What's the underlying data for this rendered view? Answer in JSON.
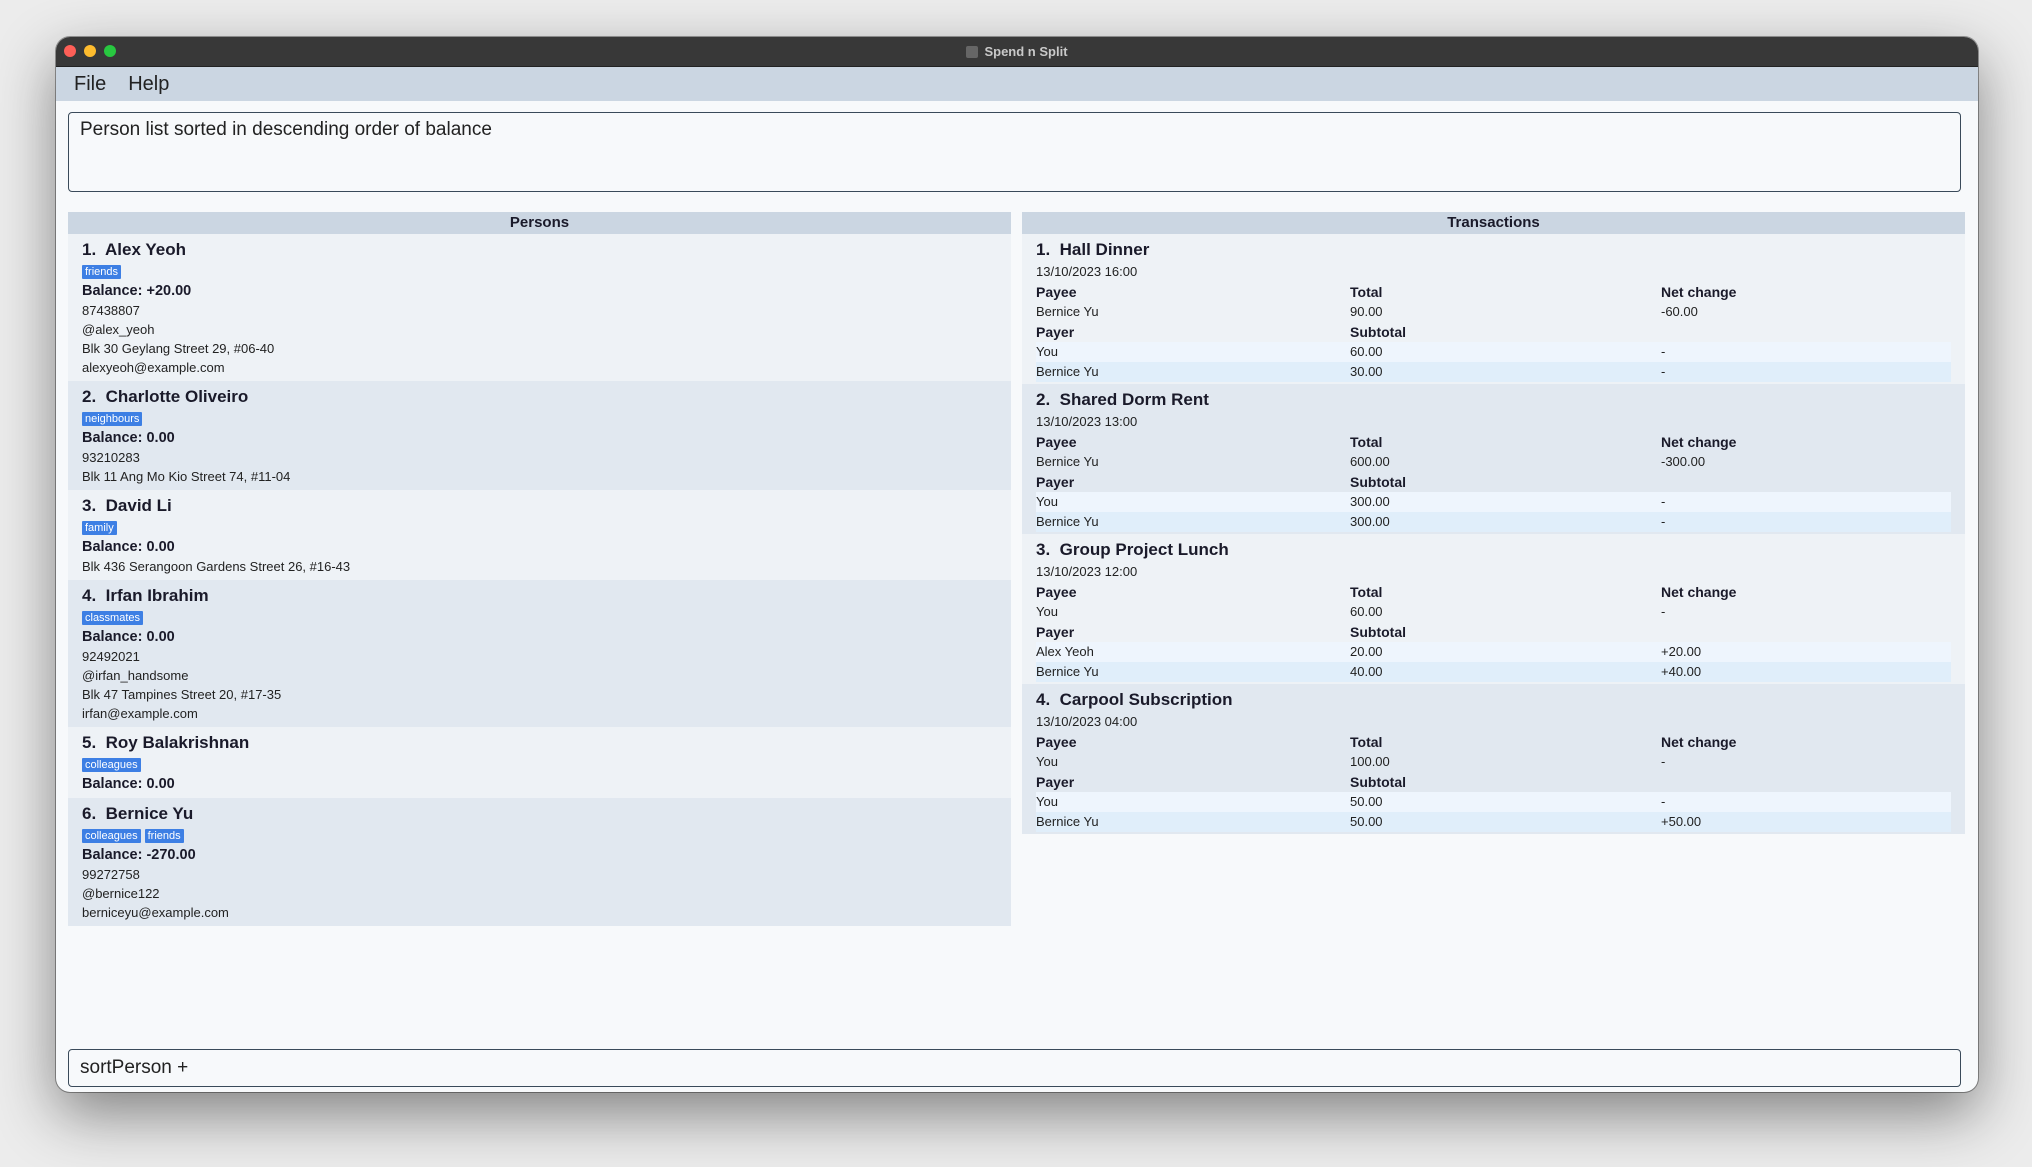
{
  "window": {
    "title": "Spend n Split"
  },
  "menu": {
    "file": "File",
    "help": "Help"
  },
  "result_message": "Person list sorted in descending order of balance",
  "persons_panel": {
    "header": "Persons",
    "items": [
      {
        "index": "1.",
        "name": "Alex Yeoh",
        "tags": [
          "friends"
        ],
        "balance": "Balance: +20.00",
        "details": [
          "87438807",
          "@alex_yeoh",
          "Blk 30 Geylang Street 29, #06-40",
          "alexyeoh@example.com"
        ]
      },
      {
        "index": "2.",
        "name": "Charlotte Oliveiro",
        "tags": [
          "neighbours"
        ],
        "balance": "Balance: 0.00",
        "details": [
          "93210283",
          "Blk 11 Ang Mo Kio Street 74, #11-04"
        ]
      },
      {
        "index": "3.",
        "name": "David Li",
        "tags": [
          "family"
        ],
        "balance": "Balance: 0.00",
        "details": [
          "Blk 436 Serangoon Gardens Street 26, #16-43"
        ]
      },
      {
        "index": "4.",
        "name": "Irfan Ibrahim",
        "tags": [
          "classmates"
        ],
        "balance": "Balance: 0.00",
        "details": [
          "92492021",
          "@irfan_handsome",
          "Blk 47 Tampines Street 20, #17-35",
          "irfan@example.com"
        ]
      },
      {
        "index": "5.",
        "name": "Roy Balakrishnan",
        "tags": [
          "colleagues"
        ],
        "balance": "Balance: 0.00",
        "details": []
      },
      {
        "index": "6.",
        "name": "Bernice Yu",
        "tags": [
          "colleagues",
          "friends"
        ],
        "balance": "Balance: -270.00",
        "details": [
          "99272758",
          "@bernice122",
          "berniceyu@example.com"
        ]
      }
    ]
  },
  "transactions_panel": {
    "header": "Transactions",
    "columns": {
      "payee": "Payee",
      "total": "Total",
      "net_change": "Net change",
      "payer": "Payer",
      "subtotal": "Subtotal"
    },
    "items": [
      {
        "index": "1.",
        "title": "Hall Dinner",
        "datetime": "13/10/2023 16:00",
        "payee": {
          "name": "Bernice Yu",
          "total": "90.00",
          "net": "-60.00"
        },
        "payers": [
          {
            "name": "You",
            "subtotal": "60.00",
            "net": "-"
          },
          {
            "name": "Bernice Yu",
            "subtotal": "30.00",
            "net": "-"
          }
        ]
      },
      {
        "index": "2.",
        "title": "Shared Dorm Rent",
        "datetime": "13/10/2023 13:00",
        "payee": {
          "name": "Bernice Yu",
          "total": "600.00",
          "net": "-300.00"
        },
        "payers": [
          {
            "name": "You",
            "subtotal": "300.00",
            "net": "-"
          },
          {
            "name": "Bernice Yu",
            "subtotal": "300.00",
            "net": "-"
          }
        ]
      },
      {
        "index": "3.",
        "title": "Group Project Lunch",
        "datetime": "13/10/2023 12:00",
        "payee": {
          "name": "You",
          "total": "60.00",
          "net": "-"
        },
        "payers": [
          {
            "name": "Alex Yeoh",
            "subtotal": "20.00",
            "net": "+20.00"
          },
          {
            "name": "Bernice Yu",
            "subtotal": "40.00",
            "net": "+40.00"
          }
        ]
      },
      {
        "index": "4.",
        "title": "Carpool Subscription",
        "datetime": "13/10/2023 04:00",
        "payee": {
          "name": "You",
          "total": "100.00",
          "net": "-"
        },
        "payers": [
          {
            "name": "You",
            "subtotal": "50.00",
            "net": "-"
          },
          {
            "name": "Bernice Yu",
            "subtotal": "50.00",
            "net": "+50.00"
          }
        ]
      }
    ]
  },
  "command_input": {
    "value": "sortPerson +"
  },
  "colors": {
    "menubar": "#cbd6e2",
    "tag": "#3d7fe4",
    "card_alt": "#e1e8f0"
  }
}
